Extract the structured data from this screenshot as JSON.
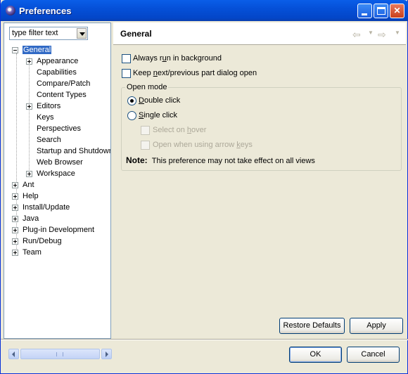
{
  "window": {
    "title": "Preferences"
  },
  "filter": {
    "text": "type filter text"
  },
  "tree": [
    {
      "label": "General",
      "level": 0,
      "expander": "minus",
      "selected": true
    },
    {
      "label": "Appearance",
      "level": 1,
      "expander": "plus"
    },
    {
      "label": "Capabilities",
      "level": 1
    },
    {
      "label": "Compare/Patch",
      "level": 1
    },
    {
      "label": "Content Types",
      "level": 1
    },
    {
      "label": "Editors",
      "level": 1,
      "expander": "plus"
    },
    {
      "label": "Keys",
      "level": 1
    },
    {
      "label": "Perspectives",
      "level": 1
    },
    {
      "label": "Search",
      "level": 1
    },
    {
      "label": "Startup and Shutdown",
      "level": 1
    },
    {
      "label": "Web Browser",
      "level": 1
    },
    {
      "label": "Workspace",
      "level": 1,
      "expander": "plus"
    },
    {
      "label": "Ant",
      "level": 0,
      "expander": "plus"
    },
    {
      "label": "Help",
      "level": 0,
      "expander": "plus"
    },
    {
      "label": "Install/Update",
      "level": 0,
      "expander": "plus"
    },
    {
      "label": "Java",
      "level": 0,
      "expander": "plus"
    },
    {
      "label": "Plug-in Development",
      "level": 0,
      "expander": "plus"
    },
    {
      "label": "Run/Debug",
      "level": 0,
      "expander": "plus"
    },
    {
      "label": "Team",
      "level": 0,
      "expander": "plus"
    }
  ],
  "page": {
    "title": "General",
    "always_run_pre": "Always r",
    "always_run_u": "u",
    "always_run_post": "n in background",
    "keep_next_pre": "Keep ",
    "keep_next_u": "n",
    "keep_next_post": "ext/previous part dialog open",
    "open_mode": "Open mode",
    "double_click_u": "D",
    "double_click_post": "ouble click",
    "single_click_u": "S",
    "single_click_post": "ingle click",
    "select_on_hover_pre": "Select on ",
    "select_on_hover_u": "h",
    "select_on_hover_post": "over",
    "open_arrow_pre": "Open when using arrow ",
    "open_arrow_u": "k",
    "open_arrow_post": "eys",
    "note_label": "Note:",
    "note_text": "This preference may not take effect on all views",
    "restore_defaults": "Restore Defaults",
    "apply": "Apply"
  },
  "dialog": {
    "ok": "OK",
    "cancel": "Cancel"
  },
  "icons": {
    "back": "back-arrow-icon",
    "forward": "forward-arrow-icon"
  }
}
